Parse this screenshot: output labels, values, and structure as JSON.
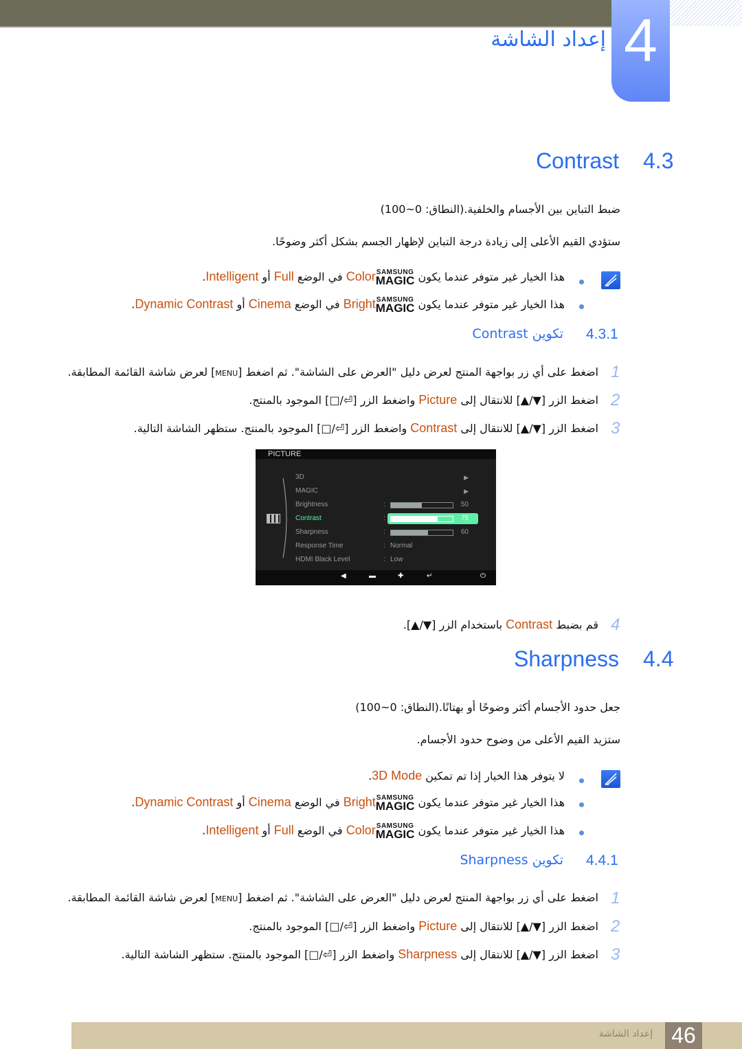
{
  "chapter": {
    "number": "4",
    "title": "إعداد الشاشة"
  },
  "colors": {
    "heading": "#2a6ef0",
    "highlight": "#c8500f",
    "step_number": "#9ab8f0",
    "topbar": "#6b6b58",
    "footer": "#d4c8a8"
  },
  "contrast": {
    "number": "4.3",
    "title": "Contrast",
    "desc": [
      [
        [
          "t",
          "ضبط التباين بين الأجسام والخلفية.(النطاق: 0~100)"
        ]
      ],
      [
        [
          "t",
          "ستؤدي القيم الأعلى إلى زيادة درجة التباين لإظهار الجسم بشكل أكثر وضوحًا."
        ]
      ]
    ],
    "notes": [
      [
        [
          "t",
          "هذا الخيار غير متوفر عندما يكون "
        ],
        [
          "m",
          "SAMSUNG|MAGIC"
        ],
        [
          "h",
          "Color"
        ],
        [
          "t",
          " في الوضع "
        ],
        [
          "h",
          "Full"
        ],
        [
          "t",
          " أو "
        ],
        [
          "h",
          "Intelligent"
        ],
        [
          "t",
          "."
        ]
      ],
      [
        [
          "t",
          "هذا الخيار غير متوفر عندما يكون "
        ],
        [
          "m",
          "SAMSUNG|MAGIC"
        ],
        [
          "h",
          "Bright"
        ],
        [
          "t",
          " في الوضع "
        ],
        [
          "h",
          "Cinema"
        ],
        [
          "t",
          " أو "
        ],
        [
          "h",
          "Dynamic Contrast"
        ],
        [
          "t",
          "."
        ]
      ]
    ],
    "sub": {
      "number": "4.3.1",
      "title": "تكوين Contrast"
    },
    "steps": [
      {
        "n": "1",
        "segs": [
          [
            "t",
            "اضغط على أي زر بواجهة المنتج لعرض دليل \"العرض على الشاشة\". ثم اضغط ["
          ],
          [
            "k",
            "MENU"
          ],
          [
            "t",
            "] لعرض شاشة القائمة المطابقة."
          ]
        ]
      },
      {
        "n": "2",
        "segs": [
          [
            "t",
            "اضغط الزر [▼/▲] للانتقال إلى "
          ],
          [
            "h",
            "Picture"
          ],
          [
            "t",
            " واضغط الزر [⏎/□] الموجود بالمنتج."
          ]
        ]
      },
      {
        "n": "3",
        "segs": [
          [
            "t",
            "اضغط الزر [▼/▲] للانتقال إلى "
          ],
          [
            "h",
            "Contrast"
          ],
          [
            "t",
            " واضغط الزر [⏎/□] الموجود بالمنتج. ستظهر الشاشة التالية."
          ]
        ]
      },
      {
        "n": "4",
        "segs": [
          [
            "t",
            "قم بضبط "
          ],
          [
            "h",
            "Contrast"
          ],
          [
            "t",
            " باستخدام الزر [▼/▲]."
          ]
        ]
      }
    ]
  },
  "osd": {
    "title": "PICTURE",
    "items": [
      {
        "label": "3D",
        "type": "submenu"
      },
      {
        "label": "MAGIC",
        "type": "submenu"
      },
      {
        "label": "Brightness",
        "type": "slider",
        "value": 50
      },
      {
        "label": "Contrast",
        "type": "slider",
        "value": 75,
        "selected": true
      },
      {
        "label": "Sharpness",
        "type": "slider",
        "value": 60
      },
      {
        "label": "Response Time",
        "type": "text",
        "value": "Normal"
      },
      {
        "label": "HDMI Black Level",
        "type": "text",
        "value": "Low"
      }
    ],
    "buttons": [
      "left-icon",
      "minus-icon",
      "plus-icon",
      "enter-icon",
      "power-icon"
    ]
  },
  "sharpness": {
    "number": "4.4",
    "title": "Sharpness",
    "desc": [
      [
        [
          "t",
          "جعل حدود الأجسام أكثر وضوحًا أو بهتانًا.(النطاق: 0~100)"
        ]
      ],
      [
        [
          "t",
          "ستزيد القيم الأعلى من وضوح حدود الأجسام."
        ]
      ]
    ],
    "notes": [
      [
        [
          "t",
          "لا يتوفر هذا الخيار إذا تم تمكين "
        ],
        [
          "h",
          "3D Mode"
        ],
        [
          "t",
          "."
        ]
      ],
      [
        [
          "t",
          "هذا الخيار غير متوفر عندما يكون "
        ],
        [
          "m",
          "SAMSUNG|MAGIC"
        ],
        [
          "h",
          "Bright"
        ],
        [
          "t",
          " في الوضع "
        ],
        [
          "h",
          "Cinema"
        ],
        [
          "t",
          " أو "
        ],
        [
          "h",
          "Dynamic Contrast"
        ],
        [
          "t",
          "."
        ]
      ],
      [
        [
          "t",
          "هذا الخيار غير متوفر عندما يكون "
        ],
        [
          "m",
          "SAMSUNG|MAGIC"
        ],
        [
          "h",
          "Color"
        ],
        [
          "t",
          " في الوضع "
        ],
        [
          "h",
          "Full"
        ],
        [
          "t",
          " أو "
        ],
        [
          "h",
          "Intelligent"
        ],
        [
          "t",
          "."
        ]
      ]
    ],
    "sub": {
      "number": "4.4.1",
      "title": "تكوين Sharpness"
    },
    "steps": [
      {
        "n": "1",
        "segs": [
          [
            "t",
            "اضغط على أي زر بواجهة المنتج لعرض دليل \"العرض على الشاشة\". ثم اضغط ["
          ],
          [
            "k",
            "MENU"
          ],
          [
            "t",
            "] لعرض شاشة القائمة المطابقة."
          ]
        ]
      },
      {
        "n": "2",
        "segs": [
          [
            "t",
            "اضغط الزر [▼/▲] للانتقال إلى "
          ],
          [
            "h",
            "Picture"
          ],
          [
            "t",
            " واضغط الزر [⏎/□] الموجود بالمنتج."
          ]
        ]
      },
      {
        "n": "3",
        "segs": [
          [
            "t",
            "اضغط الزر [▼/▲] للانتقال إلى "
          ],
          [
            "h",
            "Sharpness"
          ],
          [
            "t",
            " واضغط الزر [⏎/□] الموجود بالمنتج. ستظهر الشاشة التالية."
          ]
        ]
      }
    ]
  },
  "footer": {
    "title": "إعداد الشاشة",
    "page": "46"
  }
}
